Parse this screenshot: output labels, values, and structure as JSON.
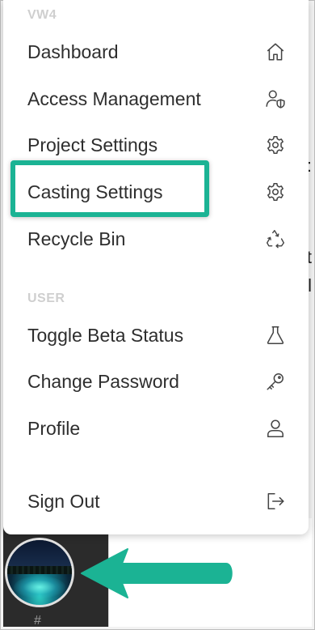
{
  "menu": {
    "sections": {
      "workspace_label": "VW4",
      "user_label": "USER"
    },
    "items": [
      {
        "label": "Dashboard",
        "icon": "home-icon"
      },
      {
        "label": "Access Management",
        "icon": "user-shield-icon"
      },
      {
        "label": "Project Settings",
        "icon": "gear-icon"
      },
      {
        "label": "Casting Settings",
        "icon": "gear-icon"
      },
      {
        "label": "Recycle Bin",
        "icon": "recycle-icon"
      },
      {
        "label": "Toggle Beta Status",
        "icon": "flask-icon"
      },
      {
        "label": "Change Password",
        "icon": "key-icon"
      },
      {
        "label": "Profile",
        "icon": "user-icon"
      },
      {
        "label": "Sign Out",
        "icon": "sign-out-icon"
      }
    ]
  },
  "background": {
    "hash": "#",
    "peek_chars": [
      ":",
      "t",
      "l"
    ]
  },
  "colors": {
    "highlight": "#1bb394",
    "menu_text": "#2e2e2e",
    "section_label": "#cfcfcf"
  }
}
